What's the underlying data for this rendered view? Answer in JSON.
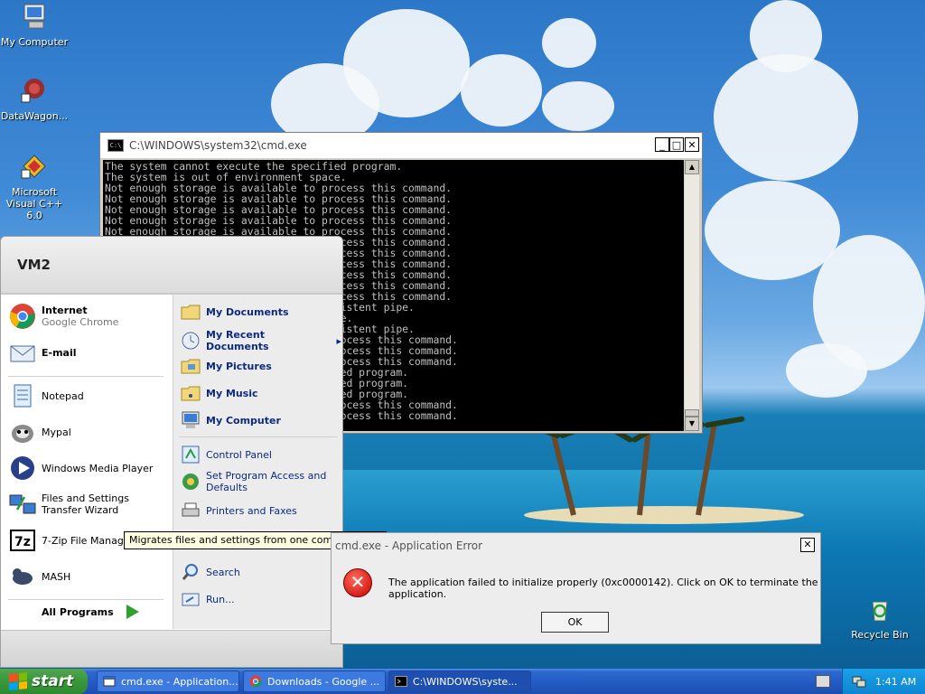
{
  "desktop": {
    "icons": [
      {
        "label": "My Computer",
        "icon": "my-computer-icon"
      },
      {
        "label": "DataWagon...",
        "icon": "datawagon-icon"
      },
      {
        "label": "Microsoft Visual C++ 6.0",
        "icon": "visual-cpp-icon"
      },
      {
        "label": "Recycle Bin",
        "icon": "recycle-bin-icon"
      }
    ]
  },
  "cmd_window": {
    "title": "C:\\WINDOWS\\system32\\cmd.exe",
    "lines": [
      "The system cannot execute the specified program.",
      "The system is out of environment space.",
      "Not enough storage is available to process this command.",
      "Not enough storage is available to process this command.",
      "Not enough storage is available to process this command.",
      "Not enough storage is available to process this command.",
      "Not enough storage is available to process this command.",
      "Not enough storage is available to process this command.",
      "Not enough storage is available to process this command.",
      "Not enough storage is available to process this command.",
      "Not enough storage is available to process this command.",
      "Not enough storage is available to process this command.",
      "Not enough storage is available to process this command.",
      "                                  onexistent pipe.",
      "                                  space.",
      "                                  onexistent pipe.",
      "                                  o process this command.",
      "                                  o process this command.",
      "                                  o process this command.",
      "                                  cified program.",
      "                                  cified program.",
      "                                  cified program.",
      "                                  o process this command.",
      "                                  o process this command."
    ],
    "buttons": {
      "minimize": "_",
      "maximize": "□",
      "close": "✕"
    }
  },
  "start_menu": {
    "user": "VM2",
    "pinned": [
      {
        "label": "Internet",
        "sub": "Google Chrome",
        "icon": "chrome-icon"
      },
      {
        "label": "E-mail",
        "icon": "email-icon"
      }
    ],
    "recent": [
      {
        "label": "Notepad",
        "icon": "notepad-icon"
      },
      {
        "label": "Mypal",
        "icon": "mypal-icon"
      },
      {
        "label": "Windows Media Player",
        "icon": "media-player-icon"
      },
      {
        "label": "Files and Settings Transfer Wizard",
        "icon": "transfer-wizard-icon"
      },
      {
        "label": "7-Zip File Manager",
        "icon": "7zip-icon"
      },
      {
        "label": "MASH",
        "icon": "mash-icon"
      }
    ],
    "all_programs": "All Programs",
    "right": [
      {
        "label": "My Documents",
        "icon": "folder-documents-icon",
        "bold": true
      },
      {
        "label": "My Recent Documents",
        "icon": "recent-documents-icon",
        "bold": true,
        "arrow": "▸"
      },
      {
        "label": "My Pictures",
        "icon": "folder-pictures-icon",
        "bold": true
      },
      {
        "label": "My Music",
        "icon": "folder-music-icon",
        "bold": true
      },
      {
        "label": "My Computer",
        "icon": "computer-icon",
        "bold": true
      },
      {
        "label": "Control Panel",
        "icon": "control-panel-icon",
        "bold": false
      },
      {
        "label": "Set Program Access and Defaults",
        "icon": "program-defaults-icon",
        "bold": false
      },
      {
        "label": "Printers and Faxes",
        "icon": "printer-icon",
        "bold": false
      },
      {
        "label": "Search",
        "icon": "search-icon",
        "bold": false
      },
      {
        "label": "Run...",
        "icon": "run-icon",
        "bold": false
      }
    ]
  },
  "tooltip": "Migrates files and settings from one computer",
  "error_dialog": {
    "title": "cmd.exe - Application Error",
    "message": "The application failed to initialize properly (0xc0000142). Click on OK to terminate the application.",
    "ok": "OK",
    "close": "✕",
    "icon": "error-icon"
  },
  "taskbar": {
    "start": "start",
    "buttons": [
      {
        "label": "cmd.exe - Application...",
        "icon": "dialog-icon"
      },
      {
        "label": "Downloads - Google ...",
        "icon": "chrome-icon"
      },
      {
        "label": "C:\\WINDOWS\\syste...",
        "icon": "cmd-icon"
      }
    ],
    "clock": "1:41 AM"
  }
}
